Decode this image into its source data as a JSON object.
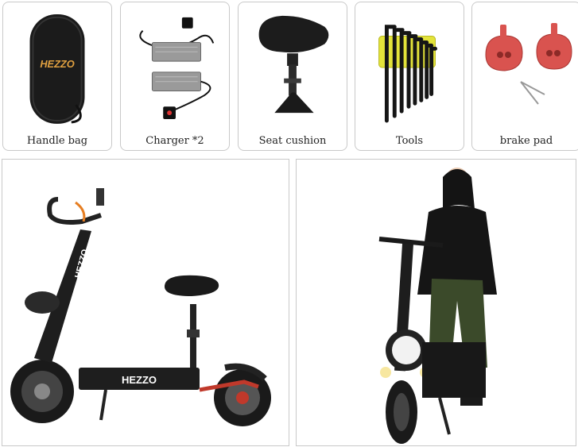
{
  "accessories": [
    {
      "label": "Handle bag",
      "logo": "HEZZO"
    },
    {
      "label": "Charger *2"
    },
    {
      "label": "Seat cushion"
    },
    {
      "label": "Tools"
    },
    {
      "label": "brake pad"
    }
  ],
  "scooter": {
    "deck_brand": "HEZZO",
    "stem_brand": "HEZZO"
  },
  "colors": {
    "bag_logo": "#e0a040",
    "brake_pad": "#d9534f",
    "allen_key_holder": "#e3e33a",
    "accent_red": "#c0392b"
  }
}
